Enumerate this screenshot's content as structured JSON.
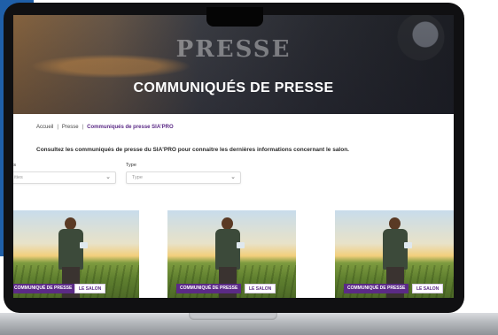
{
  "hero": {
    "watermark": "PRESSE",
    "title": "COMMUNIQUÉS DE PRESSE"
  },
  "breadcrumb": {
    "items": [
      "Accueil",
      "Presse",
      "Communiqués de presse SIA'PRO"
    ],
    "separator": "|"
  },
  "intro_text": "Consultez les communiqués de presse du SIA'PRO pour connaitre les dernières informations concernant le salon.",
  "filters": [
    {
      "label": "ies",
      "placeholder": "ities"
    },
    {
      "label": "Type",
      "placeholder": "Type"
    }
  ],
  "cards": [
    {
      "tags": [
        "COMMUNIQUÉ DE PRESSE",
        "LE SALON"
      ]
    },
    {
      "tags": [
        "COMMUNIQUÉ DE PRESSE",
        "LE SALON"
      ]
    },
    {
      "tags": [
        "COMMUNIQUÉ DE PRESSE",
        "LE SALON"
      ]
    }
  ],
  "colors": {
    "accent_purple": "#5b2a86",
    "corner_blue": "#1f5fa8"
  },
  "icons": {
    "select_chevron": "chevron-down-icon"
  }
}
